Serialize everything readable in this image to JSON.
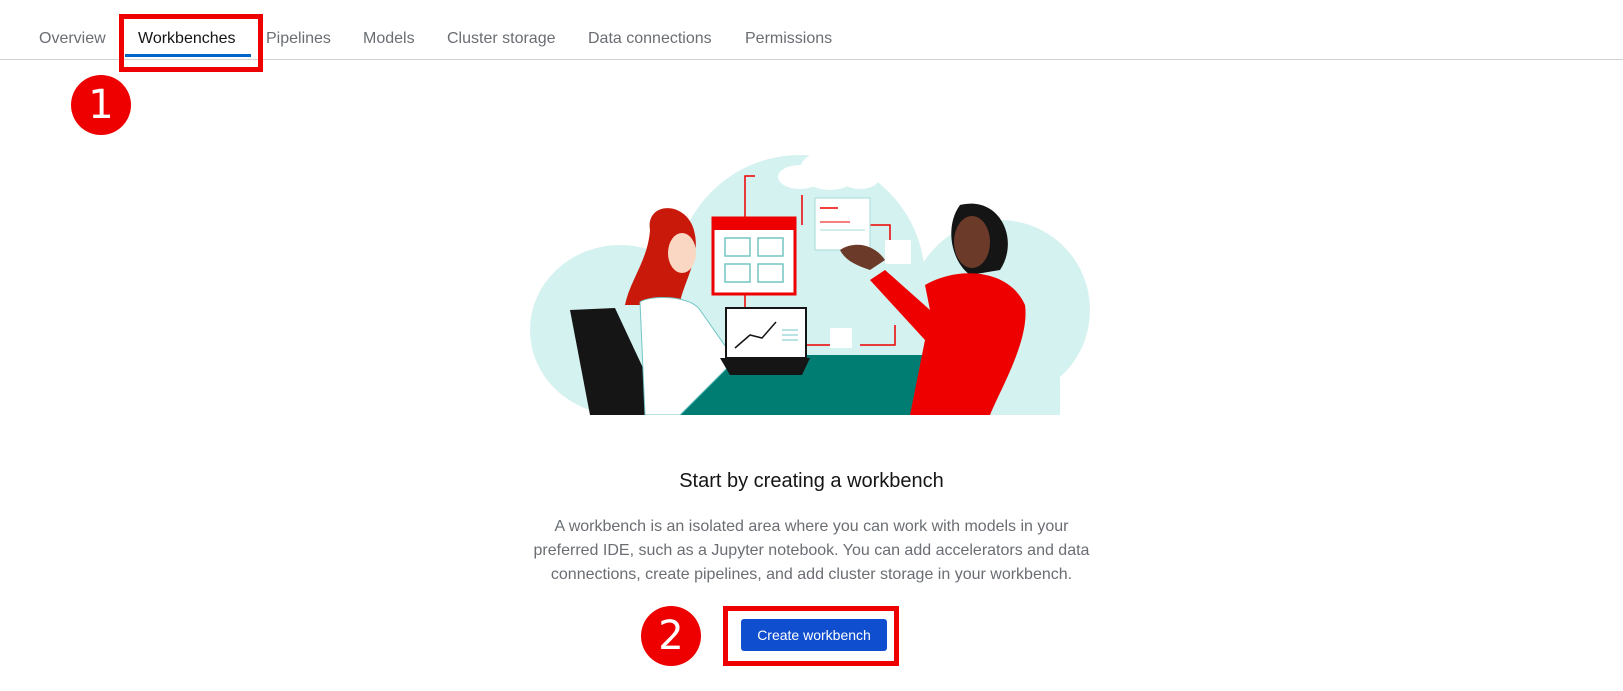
{
  "tabs": [
    {
      "label": "Overview",
      "active": false
    },
    {
      "label": "Workbenches",
      "active": true
    },
    {
      "label": "Pipelines",
      "active": false
    },
    {
      "label": "Models",
      "active": false
    },
    {
      "label": "Cluster storage",
      "active": false
    },
    {
      "label": "Data connections",
      "active": false
    },
    {
      "label": "Permissions",
      "active": false
    }
  ],
  "annotations": {
    "step1": "1",
    "step2": "2",
    "color": "#ee0000"
  },
  "empty_state": {
    "illustration": "people-working-with-workbench-illustration",
    "title": "Start by creating a workbench",
    "body": "A workbench is an isolated area where you can work with models in your preferred IDE, such as a Jupyter notebook. You can add accelerators and data connections, create pipelines, and add cluster storage in your workbench.",
    "button_label": "Create workbench"
  },
  "colors": {
    "accent": "#0066cc",
    "button": "#0f4ecf",
    "illustration_bg": "#d4f2ef",
    "illustration_red": "#ee0000",
    "illustration_teal": "#007d72"
  }
}
